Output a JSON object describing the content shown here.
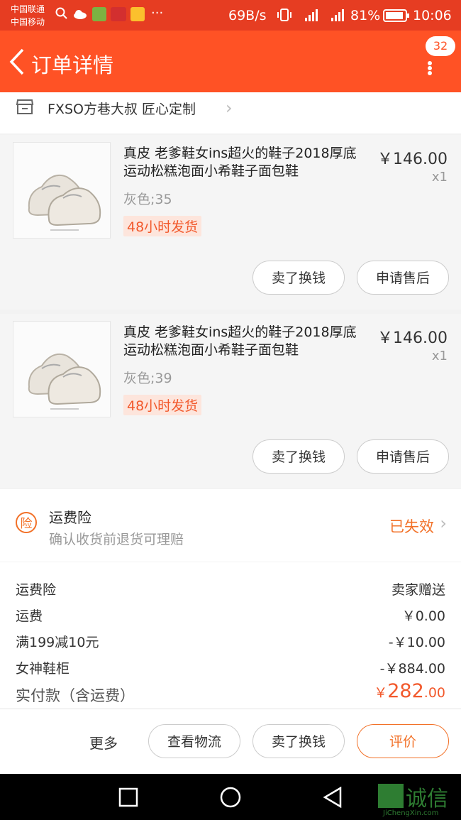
{
  "status_bar": {
    "carrier1": "中国联通",
    "carrier2": "中国移动",
    "speed": "69B/s",
    "battery_pct": "81%",
    "time": "10:06"
  },
  "header": {
    "title": "订单详情",
    "badge_count": "32"
  },
  "shop": {
    "name": "FXSO方巷大叔 匠心定制"
  },
  "items": [
    {
      "name": "真皮 老爹鞋女ins超火的鞋子2018厚底运动松糕泡面小希鞋子面包鞋",
      "price": "￥146.00",
      "qty": "x1",
      "spec": "灰色;35",
      "ship_tag": "48小时发货",
      "btn_sell": "卖了换钱",
      "btn_after_sale": "申请售后"
    },
    {
      "name": "真皮 老爹鞋女ins超火的鞋子2018厚底运动松糕泡面小希鞋子面包鞋",
      "price": "￥146.00",
      "qty": "x1",
      "spec": "灰色;39",
      "ship_tag": "48小时发货",
      "btn_sell": "卖了换钱",
      "btn_after_sale": "申请售后"
    }
  ],
  "insurance": {
    "icon_char": "险",
    "title": "运费险",
    "subtitle": "确认收货前退货可理赔",
    "status": "已失效"
  },
  "summary": {
    "rows": [
      {
        "label": "运费险",
        "value": "卖家赠送"
      },
      {
        "label": "运费",
        "value": "￥0.00"
      },
      {
        "label": "满199减10元",
        "value": "-￥10.00"
      },
      {
        "label": "女神鞋柜",
        "value": "-￥884.00"
      }
    ],
    "total_label": "实付款（含运费）",
    "total_currency": "￥",
    "total_int": "282",
    "total_dec": ".00"
  },
  "bottom_bar": {
    "more": "更多",
    "logistics": "查看物流",
    "sell": "卖了换钱",
    "review": "评价"
  },
  "watermark": {
    "name": "诚信",
    "url": "JiChengXin.com"
  },
  "colors": {
    "accent": "#ff5225",
    "orange": "#f27128"
  }
}
